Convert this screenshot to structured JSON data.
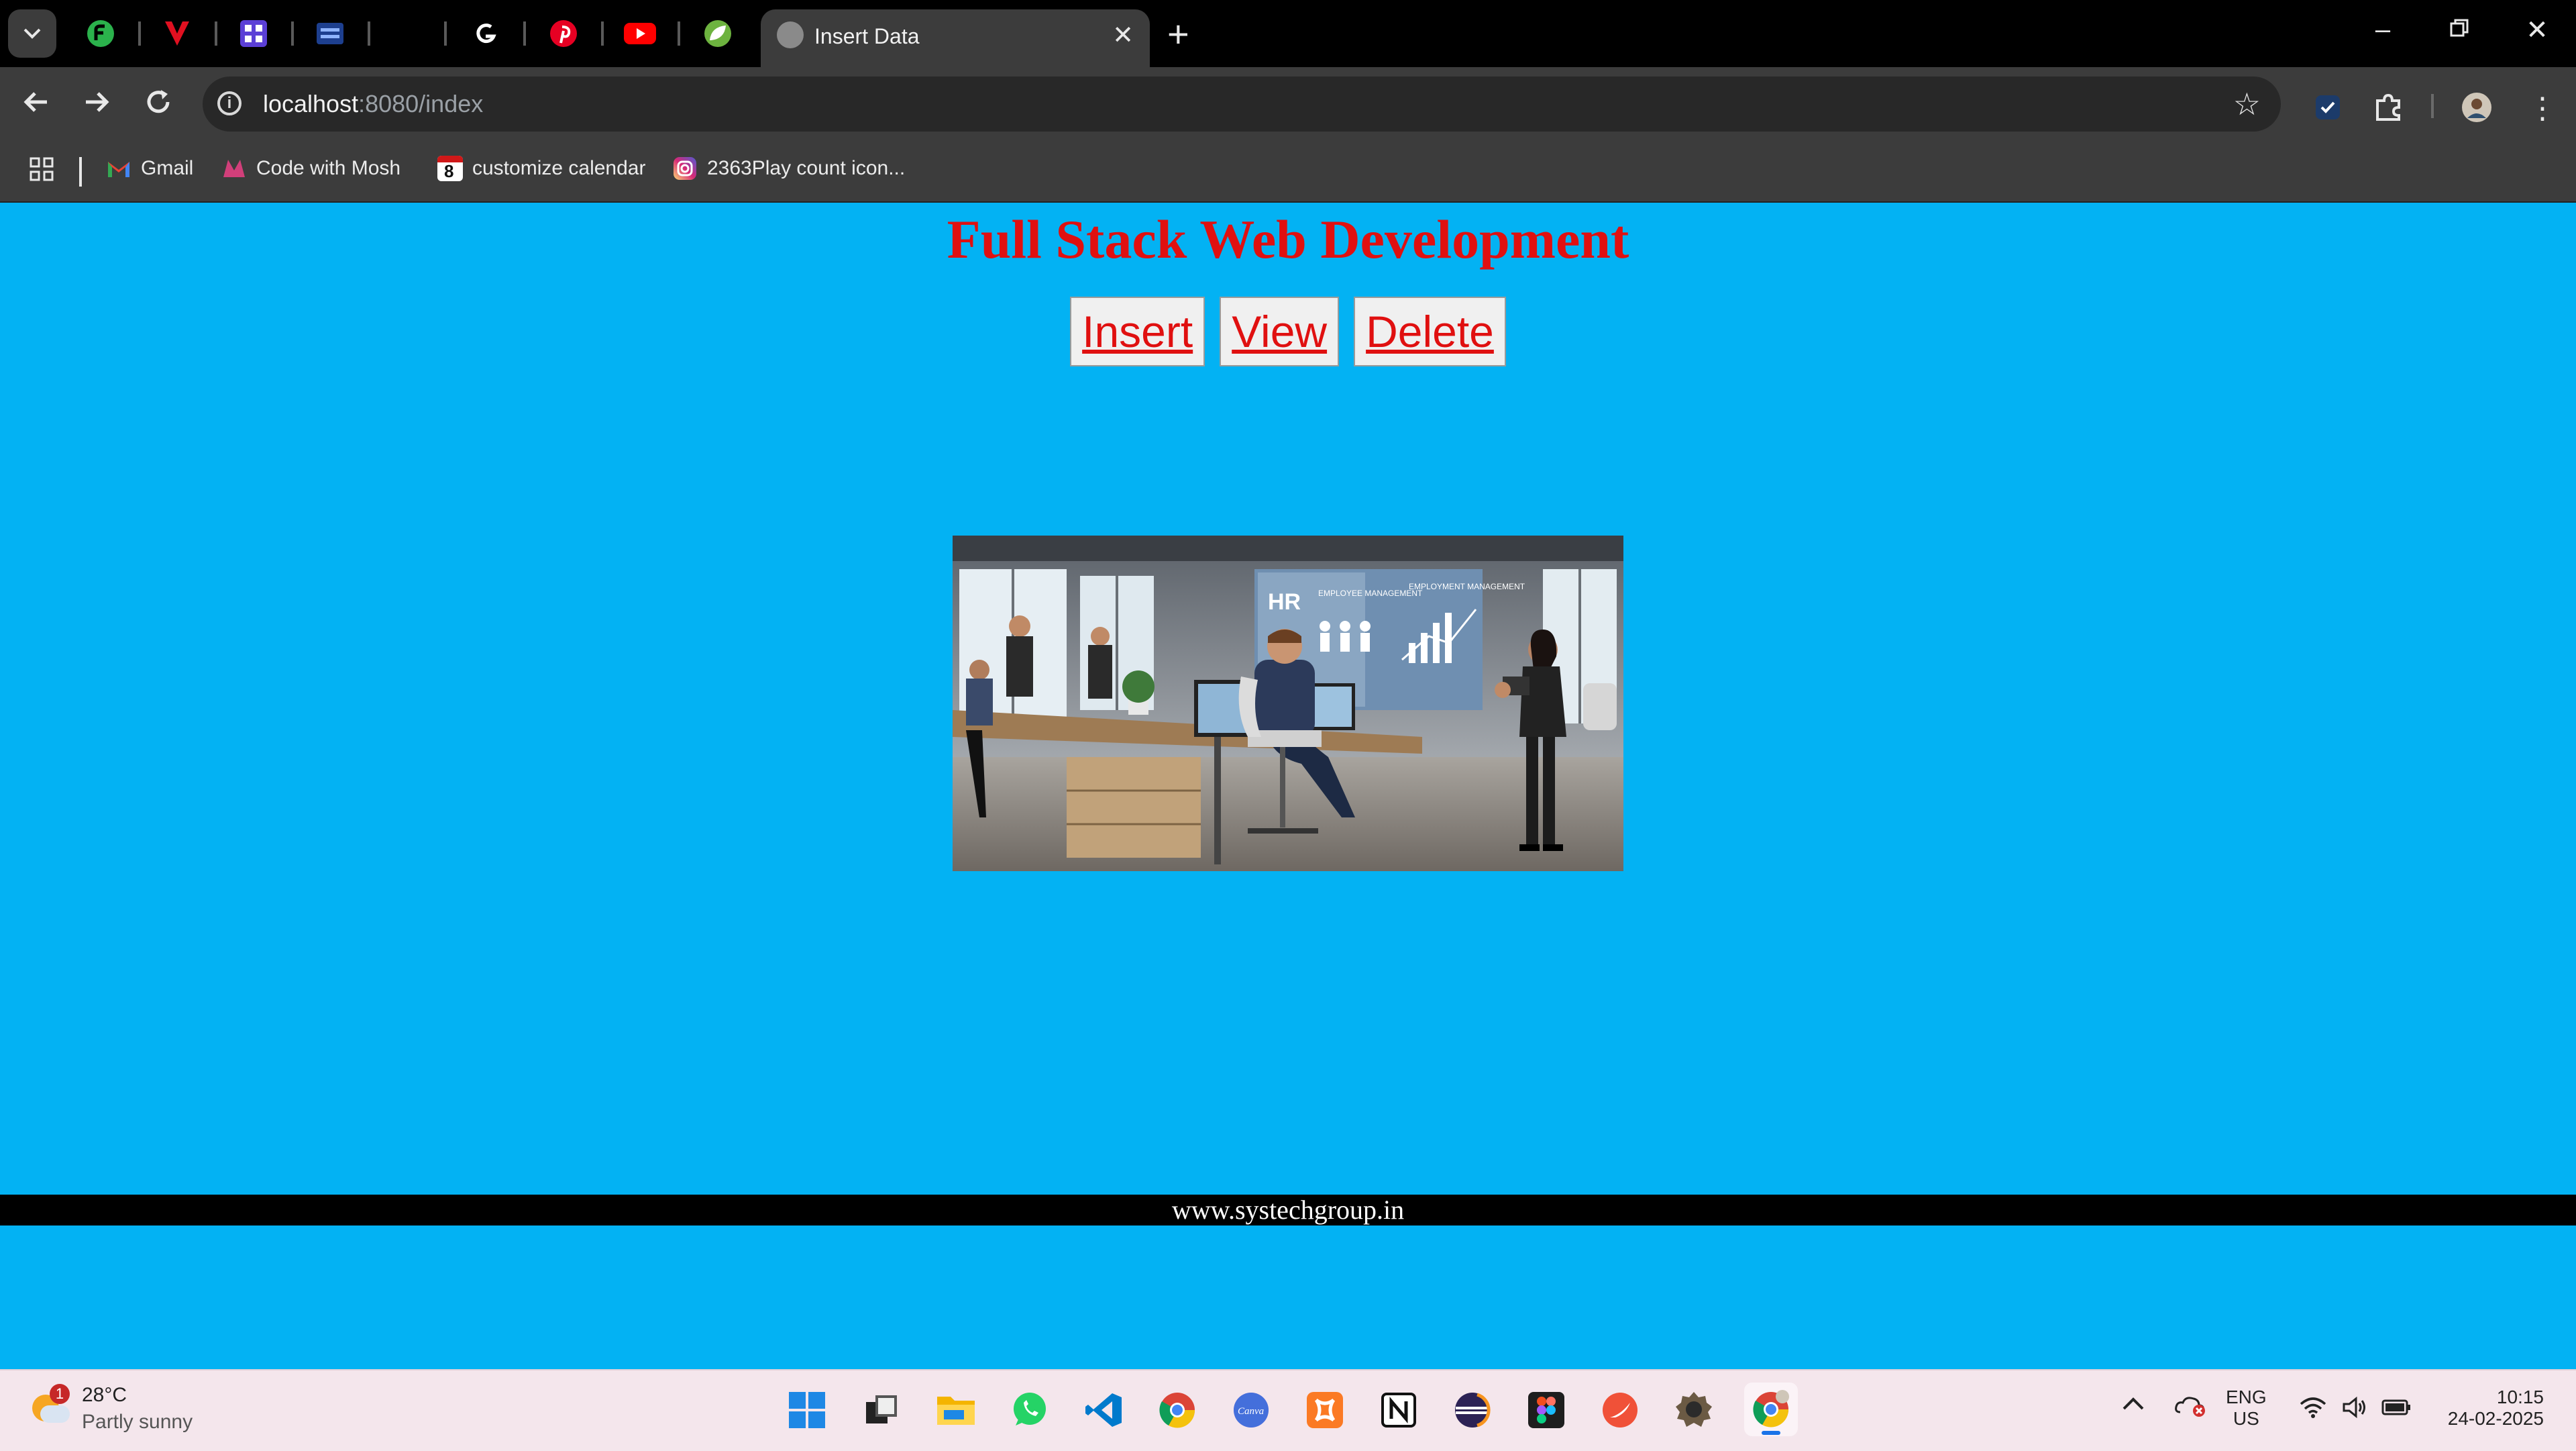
{
  "browser": {
    "active_tab_title": "Insert Data",
    "url_host": "localhost",
    "url_path": ":8080/index",
    "bookmarks": [
      {
        "label": "Gmail"
      },
      {
        "label": "Code with Mosh"
      },
      {
        "label": "customize calendar"
      },
      {
        "label": "2363Play count icon..."
      }
    ],
    "bookmark_badge": "8"
  },
  "page": {
    "heading": "Full Stack Web Development",
    "nav": {
      "insert": "Insert",
      "view": "View",
      "delete": "Delete"
    },
    "hero_texts": {
      "hr": "HR",
      "panel1": "EMPLOYEE MANAGEMENT",
      "panel2": "EMPLOYMENT MANAGEMENT"
    },
    "footer": "www.systechgroup.in"
  },
  "taskbar": {
    "weather_badge": "1",
    "temperature": "28°C",
    "condition": "Partly sunny",
    "lang_primary": "ENG",
    "lang_secondary": "US",
    "time": "10:15",
    "date": "24-02-2025"
  },
  "colors": {
    "page_bg": "#03b2f3",
    "heading": "#e01010",
    "link": "#e01010"
  }
}
